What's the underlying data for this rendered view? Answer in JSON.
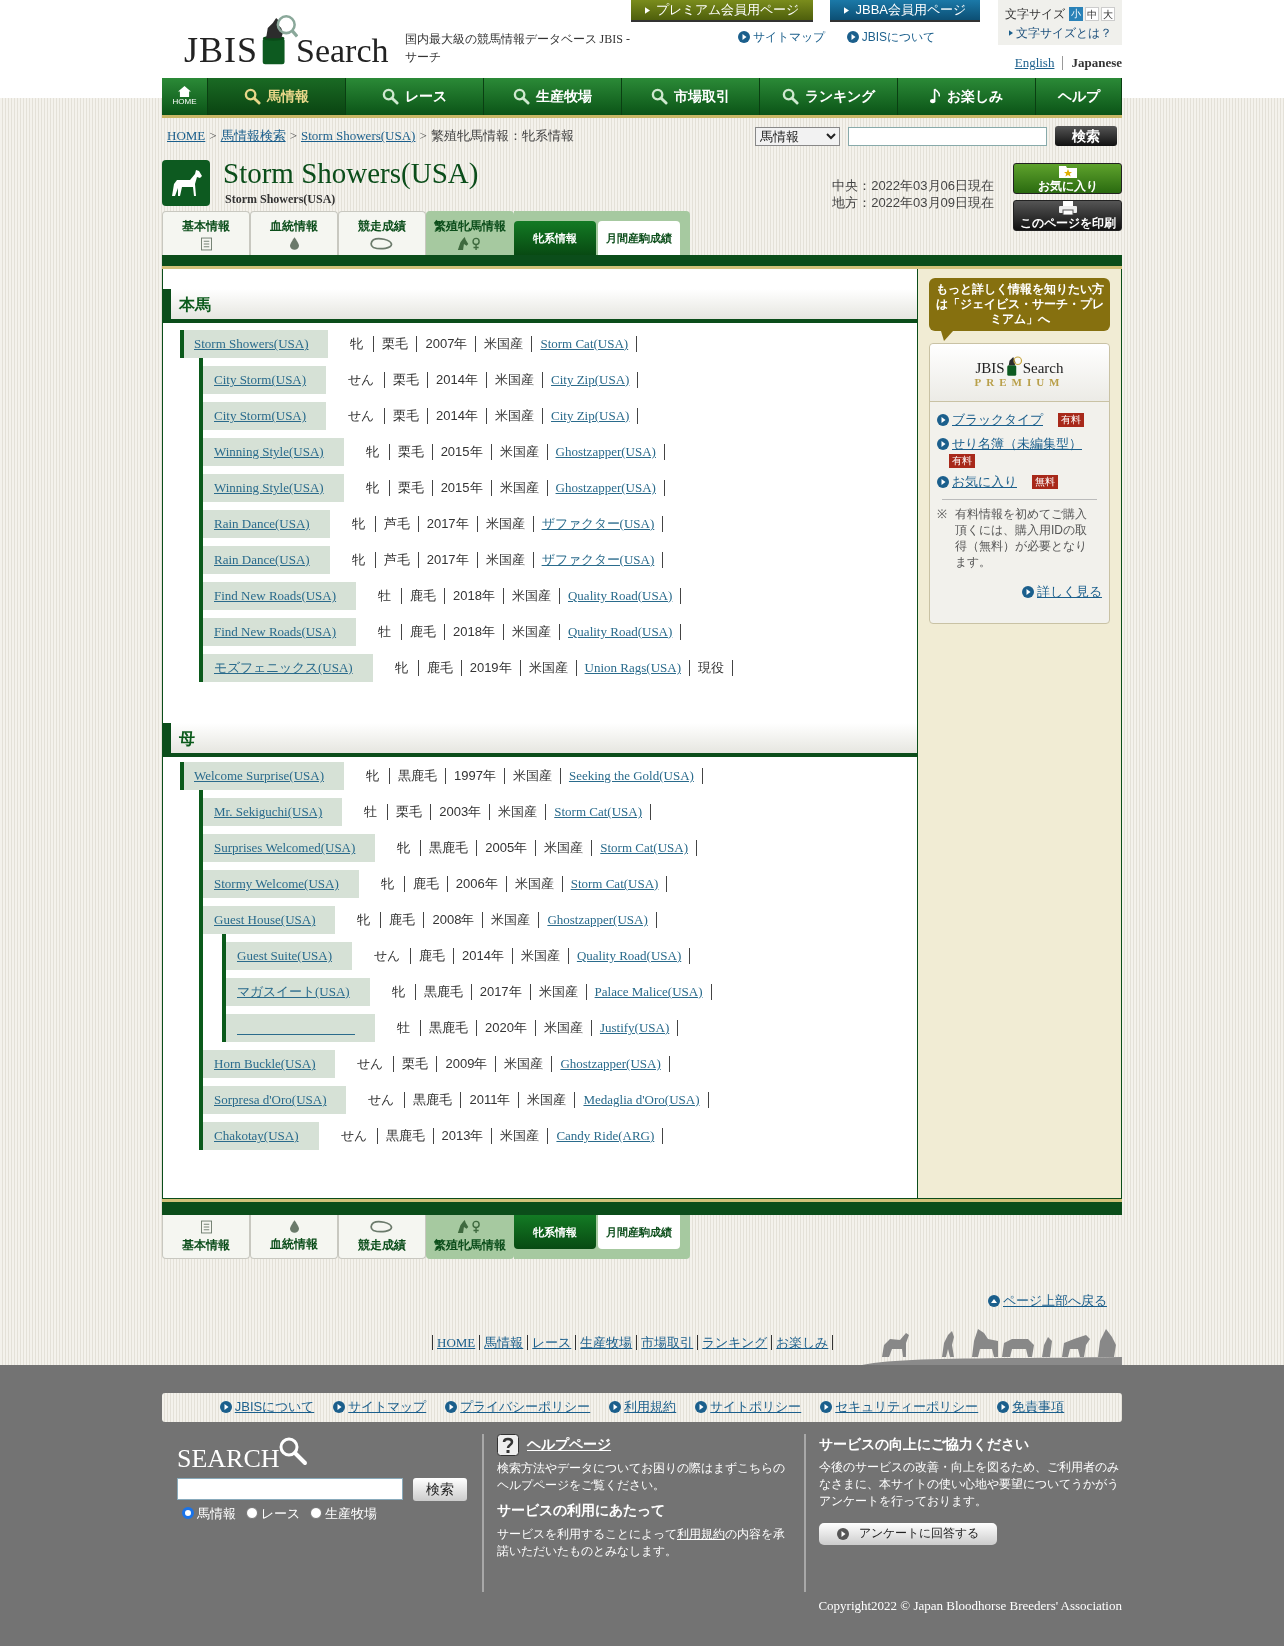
{
  "header": {
    "logo": {
      "left": "JBIS",
      "right": "Search"
    },
    "tagline": "国内最大級の競馬情報データベース JBIS - サーチ",
    "member_buttons": [
      {
        "label": "プレミアム会員用ページ",
        "kind": "premium"
      },
      {
        "label": "JBBA会員用ページ",
        "kind": "jbba"
      }
    ],
    "links": [
      "サイトマップ",
      "JBISについて"
    ],
    "font_size": {
      "label": "文字サイズ",
      "options": [
        {
          "label": "小",
          "selected": true
        },
        {
          "label": "中",
          "selected": false
        },
        {
          "label": "大",
          "selected": false
        }
      ],
      "help": "文字サイズとは？"
    },
    "languages": [
      {
        "label": "English",
        "selected": false
      },
      {
        "label": "Japanese",
        "selected": true
      }
    ]
  },
  "nav": [
    {
      "label": "HOME",
      "kind": "home",
      "selected": false
    },
    {
      "label": "馬情報",
      "kind": "search",
      "selected": true
    },
    {
      "label": "レース",
      "kind": "search",
      "selected": false
    },
    {
      "label": "生産牧場",
      "kind": "search",
      "selected": false
    },
    {
      "label": "市場取引",
      "kind": "search",
      "selected": false
    },
    {
      "label": "ランキング",
      "kind": "search",
      "selected": false
    },
    {
      "label": "お楽しみ",
      "kind": "note",
      "selected": false
    },
    {
      "label": "ヘルプ",
      "kind": "plain",
      "selected": false
    }
  ],
  "breadcrumb": {
    "separator": ">",
    "items": [
      {
        "label": "HOME",
        "link": true
      },
      {
        "label": "馬情報検索",
        "link": true
      },
      {
        "label": "Storm Showers(USA)",
        "link": true
      },
      {
        "label": "繁殖牝馬情報：牝系情報",
        "link": false
      }
    ]
  },
  "search": {
    "category": "馬情報",
    "button": "検索"
  },
  "horse": {
    "name": "Storm Showers(USA)",
    "subtitle": "Storm Showers(USA)",
    "dates": [
      "中央：2022年03月06日現在",
      "地方：2022年03月09日現在"
    ],
    "actions": [
      {
        "label": "お気に入り",
        "kind": "favorite"
      },
      {
        "label": "このページを印刷",
        "kind": "print"
      }
    ]
  },
  "tabs_top": [
    {
      "label": "基本情報",
      "kind": "doc",
      "selected": false
    },
    {
      "label": "血統情報",
      "kind": "drop",
      "selected": false
    },
    {
      "label": "競走成績",
      "kind": "loop",
      "selected": false
    },
    {
      "label": "繁殖牝馬情報",
      "kind": "mare",
      "selected": true
    }
  ],
  "subtabs_top": [
    {
      "label": "牝系情報",
      "selected": true
    },
    {
      "label": "月間産駒成績",
      "selected": false
    }
  ],
  "sections": [
    {
      "title": "本馬",
      "tree": {
        "name": "Storm Showers(USA)",
        "sex": "牝",
        "coat": "栗毛",
        "year": "2007年",
        "origin": "米国産",
        "sire": "Storm Cat(USA)",
        "children": [
          {
            "name": "City Storm(USA)",
            "sex": "せん",
            "coat": "栗毛",
            "year": "2014年",
            "origin": "米国産",
            "sire": "City Zip(USA)"
          },
          {
            "name": "City Storm(USA)",
            "sex": "せん",
            "coat": "栗毛",
            "year": "2014年",
            "origin": "米国産",
            "sire": "City Zip(USA)"
          },
          {
            "name": "Winning Style(USA)",
            "sex": "牝",
            "coat": "栗毛",
            "year": "2015年",
            "origin": "米国産",
            "sire": "Ghostzapper(USA)"
          },
          {
            "name": "Winning Style(USA)",
            "sex": "牝",
            "coat": "栗毛",
            "year": "2015年",
            "origin": "米国産",
            "sire": "Ghostzapper(USA)"
          },
          {
            "name": "Rain Dance(USA)",
            "sex": "牝",
            "coat": "芦毛",
            "year": "2017年",
            "origin": "米国産",
            "sire": "ザファクター(USA)"
          },
          {
            "name": "Rain Dance(USA)",
            "sex": "牝",
            "coat": "芦毛",
            "year": "2017年",
            "origin": "米国産",
            "sire": "ザファクター(USA)"
          },
          {
            "name": "Find New Roads(USA)",
            "sex": "牡",
            "coat": "鹿毛",
            "year": "2018年",
            "origin": "米国産",
            "sire": "Quality Road(USA)"
          },
          {
            "name": "Find New Roads(USA)",
            "sex": "牡",
            "coat": "鹿毛",
            "year": "2018年",
            "origin": "米国産",
            "sire": "Quality Road(USA)"
          },
          {
            "name": "モズフェニックス(USA)",
            "sex": "牝",
            "coat": "鹿毛",
            "year": "2019年",
            "origin": "米国産",
            "sire": "Union Rags(USA)",
            "status": "現役"
          }
        ]
      }
    },
    {
      "title": "母",
      "tree": {
        "name": "Welcome Surprise(USA)",
        "sex": "牝",
        "coat": "黒鹿毛",
        "year": "1997年",
        "origin": "米国産",
        "sire": "Seeking the Gold(USA)",
        "children": [
          {
            "name": "Mr. Sekiguchi(USA)",
            "sex": "牡",
            "coat": "栗毛",
            "year": "2003年",
            "origin": "米国産",
            "sire": "Storm Cat(USA)"
          },
          {
            "name": "Surprises Welcomed(USA)",
            "sex": "牝",
            "coat": "黒鹿毛",
            "year": "2005年",
            "origin": "米国産",
            "sire": "Storm Cat(USA)"
          },
          {
            "name": "Stormy Welcome(USA)",
            "sex": "牝",
            "coat": "鹿毛",
            "year": "2006年",
            "origin": "米国産",
            "sire": "Storm Cat(USA)"
          },
          {
            "name": "Guest House(USA)",
            "sex": "牝",
            "coat": "鹿毛",
            "year": "2008年",
            "origin": "米国産",
            "sire": "Ghostzapper(USA)",
            "children": [
              {
                "name": "Guest Suite(USA)",
                "sex": "せん",
                "coat": "鹿毛",
                "year": "2014年",
                "origin": "米国産",
                "sire": "Quality Road(USA)"
              },
              {
                "name": "マガスイート(USA)",
                "sex": "牝",
                "coat": "黒鹿毛",
                "year": "2017年",
                "origin": "米国産",
                "sire": "Palace Malice(USA)"
              },
              {
                "sex": "牡",
                "coat": "黒鹿毛",
                "year": "2020年",
                "origin": "米国産",
                "sire": "Justify(USA)"
              }
            ]
          },
          {
            "name": "Horn Buckle(USA)",
            "sex": "せん",
            "coat": "栗毛",
            "year": "2009年",
            "origin": "米国産",
            "sire": "Ghostzapper(USA)"
          },
          {
            "name": "Sorpresa d'Oro(USA)",
            "sex": "せん",
            "coat": "黒鹿毛",
            "year": "2011年",
            "origin": "米国産",
            "sire": "Medaglia d'Oro(USA)"
          },
          {
            "name": "Chakotay(USA)",
            "sex": "せん",
            "coat": "黒鹿毛",
            "year": "2013年",
            "origin": "米国産",
            "sire": "Candy Ride(ARG)"
          }
        ]
      }
    }
  ],
  "sidebar": {
    "callout": "もっと詳しく情報を知りたい方は「ジェイビス・サーチ・プレミアム」へ",
    "logo": {
      "left": "JBIS",
      "right": "Search",
      "sub": "PREMIUM"
    },
    "links": [
      {
        "label": "ブラックタイプ",
        "badge": "有料"
      },
      {
        "label": "せり名簿（未編集型）",
        "badge": "有料"
      },
      {
        "label": "お気に入り",
        "badge": "無料"
      }
    ],
    "note_mark": "※",
    "note": "有料情報を初めてご購入頂くには、購入用IDの取得（無料）が必要となります。",
    "more": "詳しく見る"
  },
  "tabs_bottom": [
    {
      "label": "基本情報",
      "kind": "doc",
      "selected": false
    },
    {
      "label": "血統情報",
      "kind": "drop",
      "selected": false
    },
    {
      "label": "競走成績",
      "kind": "loop",
      "selected": false
    },
    {
      "label": "繁殖牝馬情報",
      "kind": "mare",
      "selected": true
    }
  ],
  "subtabs_bottom": [
    {
      "label": "牝系情報",
      "selected": true
    },
    {
      "label": "月間産駒成績",
      "selected": false
    }
  ],
  "footer": {
    "back_to_top": "ページ上部へ戻る",
    "nav": [
      "HOME",
      "馬情報",
      "レース",
      "生産牧場",
      "市場取引",
      "ランキング",
      "お楽しみ"
    ],
    "links": [
      "JBISについて",
      "サイトマップ",
      "プライバシーポリシー",
      "利用規約",
      "サイトポリシー",
      "セキュリティーポリシー",
      "免責事項"
    ],
    "search": {
      "title": "SEARCH",
      "button": "検索",
      "options": [
        {
          "label": "馬情報",
          "selected": true
        },
        {
          "label": "レース",
          "selected": false
        },
        {
          "label": "生産牧場",
          "selected": false
        }
      ]
    },
    "help": {
      "title": "ヘルプページ",
      "text": "検索方法やデータについてお困りの際はまずこちらのヘルプページをご覧ください。",
      "usage_title": "サービスの利用にあたって",
      "usage_before": "サービスを利用することによって",
      "usage_link": "利用規約",
      "usage_after": "の内容を承諾いただいたものとみなします。"
    },
    "survey": {
      "title": "サービスの向上にご協力ください",
      "text": "今後のサービスの改善・向上を図るため、ご利用者のみなさまに、本サイトの使い心地や要望についてうかがうアンケートを行っております。",
      "button": "アンケートに回答する"
    },
    "copyright": "Copyright2022 © Japan Bloodhorse Breeders' Association"
  }
}
